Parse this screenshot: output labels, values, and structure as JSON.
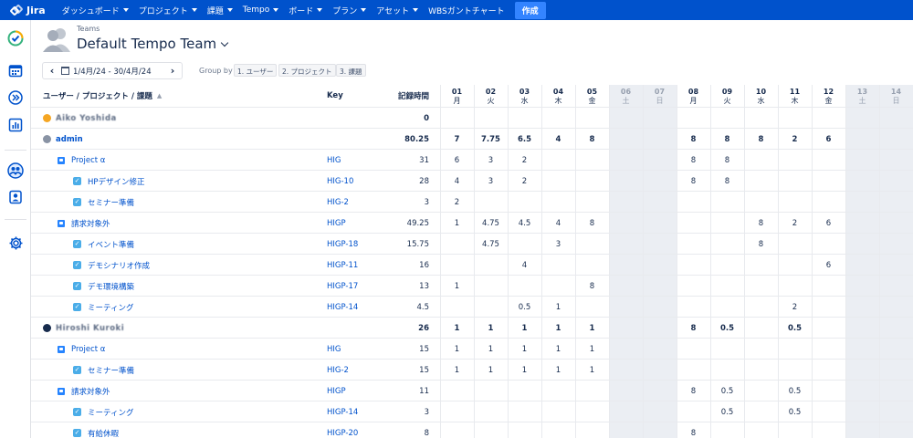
{
  "topbar": {
    "logo": "Jira",
    "nav": [
      "ダッシュボード",
      "プロジェクト",
      "課題",
      "Tempo",
      "ボード",
      "プラン",
      "アセット"
    ],
    "wbs": "WBSガントチャート",
    "create": "作成"
  },
  "header": {
    "breadcrumb": "Teams",
    "title": "Default Tempo Team"
  },
  "period": {
    "range": "1/4月/24 - 30/4月/24"
  },
  "groupby": {
    "label": "Group by",
    "chips": [
      "1. ユーザー",
      "2. プロジェクト",
      "3. 課題"
    ]
  },
  "columns": {
    "name": "ユーザー / プロジェクト / 課題",
    "key": "Key",
    "logged": "記録時間",
    "days": [
      {
        "d": "01",
        "w": "月",
        "weekend": false
      },
      {
        "d": "02",
        "w": "火",
        "weekend": false
      },
      {
        "d": "03",
        "w": "水",
        "weekend": false
      },
      {
        "d": "04",
        "w": "木",
        "weekend": false
      },
      {
        "d": "05",
        "w": "金",
        "weekend": false
      },
      {
        "d": "06",
        "w": "土",
        "weekend": true
      },
      {
        "d": "07",
        "w": "日",
        "weekend": true
      },
      {
        "d": "08",
        "w": "月",
        "weekend": false
      },
      {
        "d": "09",
        "w": "火",
        "weekend": false
      },
      {
        "d": "10",
        "w": "水",
        "weekend": false
      },
      {
        "d": "11",
        "w": "木",
        "weekend": false
      },
      {
        "d": "12",
        "w": "金",
        "weekend": false
      },
      {
        "d": "13",
        "w": "土",
        "weekend": true
      },
      {
        "d": "14",
        "w": "日",
        "weekend": true
      }
    ]
  },
  "rows": [
    {
      "type": "user",
      "name": "Aiko Yoshida",
      "blurred": true,
      "avatar": "#f5a623",
      "key": "",
      "total": "0",
      "days": [
        "",
        "",
        "",
        "",
        "",
        "",
        "",
        "",
        "",
        "",
        "",
        "",
        "",
        ""
      ]
    },
    {
      "type": "user",
      "name": "admin",
      "blurred": false,
      "avatar": "#8993a4",
      "key": "",
      "total": "80.25",
      "days": [
        "7",
        "7.75",
        "6.5",
        "4",
        "8",
        "",
        "",
        "8",
        "8",
        "8",
        "2",
        "6",
        "",
        ""
      ]
    },
    {
      "type": "project",
      "name": "Project α",
      "key": "HIG",
      "total": "31",
      "days": [
        "6",
        "3",
        "2",
        "",
        "",
        "",
        "",
        "8",
        "8",
        "",
        "",
        "",
        "",
        ""
      ]
    },
    {
      "type": "task",
      "name": "HPデザイン修正",
      "key": "HIG-10",
      "total": "28",
      "days": [
        "4",
        "3",
        "2",
        "",
        "",
        "",
        "",
        "8",
        "8",
        "",
        "",
        "",
        "",
        ""
      ]
    },
    {
      "type": "task",
      "name": "セミナー準備",
      "key": "HIG-2",
      "total": "3",
      "days": [
        "2",
        "",
        "",
        "",
        "",
        "",
        "",
        "",
        "",
        "",
        "",
        "",
        "",
        ""
      ]
    },
    {
      "type": "project",
      "name": "請求対象外",
      "key": "HIGP",
      "total": "49.25",
      "days": [
        "1",
        "4.75",
        "4.5",
        "4",
        "8",
        "",
        "",
        "",
        "",
        "8",
        "2",
        "6",
        "",
        ""
      ]
    },
    {
      "type": "task",
      "name": "イベント準備",
      "key": "HIGP-18",
      "total": "15.75",
      "days": [
        "",
        "4.75",
        "",
        "3",
        "",
        "",
        "",
        "",
        "",
        "8",
        "",
        "",
        "",
        ""
      ]
    },
    {
      "type": "task",
      "name": "デモシナリオ作成",
      "key": "HIGP-11",
      "total": "16",
      "days": [
        "",
        "",
        "4",
        "",
        "",
        "",
        "",
        "",
        "",
        "",
        "",
        "6",
        "",
        ""
      ]
    },
    {
      "type": "task",
      "name": "デモ環境構築",
      "key": "HIGP-17",
      "total": "13",
      "days": [
        "1",
        "",
        "",
        "",
        "8",
        "",
        "",
        "",
        "",
        "",
        "",
        "",
        "",
        ""
      ]
    },
    {
      "type": "task",
      "name": "ミーティング",
      "key": "HIGP-14",
      "total": "4.5",
      "days": [
        "",
        "",
        "0.5",
        "1",
        "",
        "",
        "",
        "",
        "",
        "",
        "2",
        "",
        "",
        ""
      ]
    },
    {
      "type": "user",
      "name": "Hiroshi Kuroki",
      "blurred": true,
      "avatar": "#172b4d",
      "key": "",
      "total": "26",
      "days": [
        "1",
        "1",
        "1",
        "1",
        "1",
        "",
        "",
        "8",
        "0.5",
        "",
        "0.5",
        "",
        "",
        ""
      ]
    },
    {
      "type": "project",
      "name": "Project α",
      "key": "HIG",
      "total": "15",
      "days": [
        "1",
        "1",
        "1",
        "1",
        "1",
        "",
        "",
        "",
        "",
        "",
        "",
        "",
        "",
        ""
      ]
    },
    {
      "type": "task",
      "name": "セミナー準備",
      "key": "HIG-2",
      "total": "15",
      "days": [
        "1",
        "1",
        "1",
        "1",
        "1",
        "",
        "",
        "",
        "",
        "",
        "",
        "",
        "",
        ""
      ]
    },
    {
      "type": "project",
      "name": "請求対象外",
      "key": "HIGP",
      "total": "11",
      "days": [
        "",
        "",
        "",
        "",
        "",
        "",
        "",
        "8",
        "0.5",
        "",
        "0.5",
        "",
        "",
        ""
      ]
    },
    {
      "type": "task",
      "name": "ミーティング",
      "key": "HIGP-14",
      "total": "3",
      "days": [
        "",
        "",
        "",
        "",
        "",
        "",
        "",
        "",
        "0.5",
        "",
        "0.5",
        "",
        "",
        ""
      ]
    },
    {
      "type": "task",
      "name": "有給休暇",
      "key": "HIGP-20",
      "total": "8",
      "days": [
        "",
        "",
        "",
        "",
        "",
        "",
        "",
        "8",
        "",
        "",
        "",
        "",
        "",
        ""
      ]
    }
  ]
}
